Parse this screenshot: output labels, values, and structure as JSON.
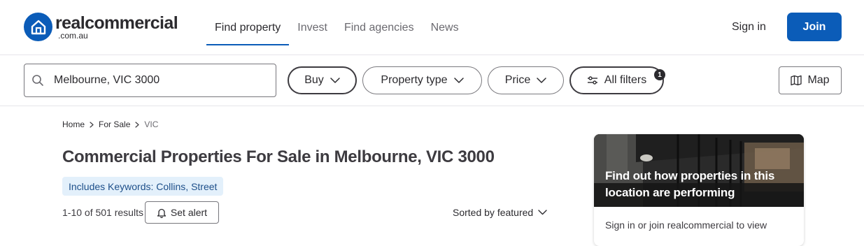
{
  "header": {
    "logo_main": "realcommercial",
    "logo_sub": ".com.au",
    "nav": [
      "Find property",
      "Invest",
      "Find agencies",
      "News"
    ],
    "active_nav": "Find property",
    "signin_label": "Sign in",
    "join_label": "Join",
    "brand_color": "#0b5cb8"
  },
  "search": {
    "value": "Melbourne, VIC 3000",
    "buy_label": "Buy",
    "property_type_label": "Property type",
    "price_label": "Price",
    "all_filters_label": "All filters",
    "filter_count": "1",
    "map_label": "Map"
  },
  "breadcrumb": [
    "Home",
    "For Sale",
    "VIC"
  ],
  "page": {
    "title": "Commercial Properties For Sale in Melbourne, VIC 3000",
    "keyword_chip": "Includes Keywords: Collins, Street",
    "results": "1-10 of 501 results",
    "set_alert_label": "Set alert",
    "sort_label": "Sorted by featured"
  },
  "promo": {
    "title": "Find out how properties in this location are performing",
    "body": "Sign in or join realcommercial to view"
  },
  "icons": {
    "logo": "house-icon",
    "search": "search-icon",
    "chevron": "chevron-down-icon",
    "filters": "sliders-icon",
    "map": "map-icon",
    "alert": "bell-icon"
  }
}
